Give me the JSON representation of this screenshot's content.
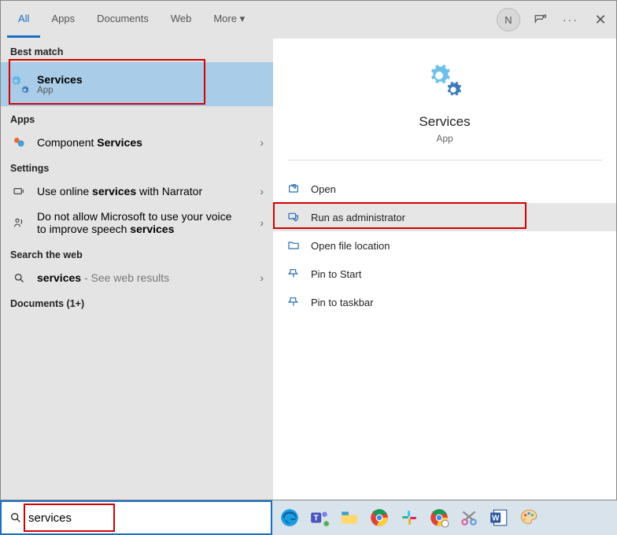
{
  "titlebar": {
    "tabs": [
      "All",
      "Apps",
      "Documents",
      "Web",
      "More ▾"
    ],
    "active_index": 0,
    "avatar_initial": "N"
  },
  "left": {
    "best_match_header": "Best match",
    "best_match": {
      "title": "Services",
      "subtitle": "App"
    },
    "apps_header": "Apps",
    "apps": [
      {
        "prefix": "Component ",
        "match": "Services"
      }
    ],
    "settings_header": "Settings",
    "settings": [
      {
        "prefix": "Use online ",
        "match": "services",
        "suffix": " with Narrator"
      },
      {
        "prefix": "Do not allow Microsoft to use your voice to improve speech ",
        "match": "services",
        "suffix": ""
      }
    ],
    "web_header": "Search the web",
    "web": {
      "match": "services",
      "suffix": " - See web results"
    },
    "documents_header": "Documents (1+)"
  },
  "right": {
    "hero_title": "Services",
    "hero_sub": "App",
    "actions": [
      {
        "icon": "open",
        "label": "Open"
      },
      {
        "icon": "admin",
        "label": "Run as administrator",
        "highlighted": true
      },
      {
        "icon": "folder",
        "label": "Open file location"
      },
      {
        "icon": "pin-start",
        "label": "Pin to Start"
      },
      {
        "icon": "pin-taskbar",
        "label": "Pin to taskbar"
      }
    ]
  },
  "search": {
    "value": "services"
  },
  "taskbar_icons": [
    "edge",
    "teams",
    "explorer",
    "chrome",
    "slack",
    "chrome2",
    "snip",
    "word",
    "paint"
  ]
}
